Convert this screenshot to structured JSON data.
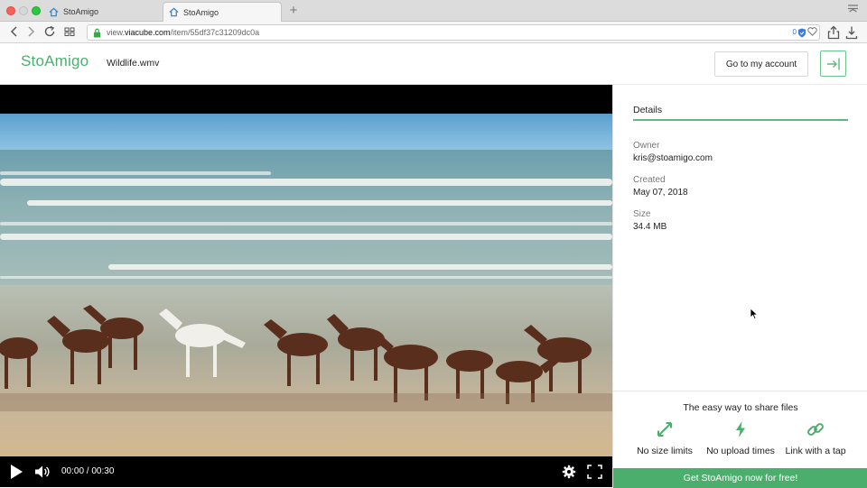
{
  "browser": {
    "tabs": [
      {
        "label": "StoAmigo",
        "active": false
      },
      {
        "label": "StoAmigo",
        "active": true
      }
    ],
    "new_tab_symbol": "+",
    "url": {
      "prefix": "view.",
      "domain": "viacube.com",
      "path": "/item/55df37c31209dc0a"
    },
    "blocked_count": "0",
    "icons": [
      "back-icon",
      "forward-icon",
      "reload-icon",
      "grid-icon",
      "lock-icon",
      "shield-icon",
      "heart-icon",
      "share-icon",
      "download-icon",
      "menu-icon"
    ]
  },
  "header": {
    "logo": "StoAmigo",
    "file_name": "Wildlife.wmv",
    "account_button": "Go to my account",
    "signout_icon": "sign-out-icon"
  },
  "player": {
    "time": "00:00 / 00:30",
    "progress": 0,
    "icons": [
      "play-icon",
      "volume-icon",
      "gear-icon",
      "fullscreen-icon"
    ]
  },
  "details": {
    "tab_label": "Details",
    "owner_label": "Owner",
    "owner_value": "kris@stoamigo.com",
    "created_label": "Created",
    "created_value": "May 07, 2018",
    "size_label": "Size",
    "size_value": "34.4 MB"
  },
  "promo": {
    "title": "The easy way to share files",
    "features": [
      {
        "label": "No size limits",
        "icon": "expand-arrows-icon"
      },
      {
        "label": "No upload times",
        "icon": "lightning-icon"
      },
      {
        "label": "Link with a tap",
        "icon": "link-icon"
      }
    ],
    "cta": "Get StoAmigo now for free!"
  },
  "colors": {
    "brand_green": "#4cae6d",
    "accent_line": "#5fb97e"
  }
}
